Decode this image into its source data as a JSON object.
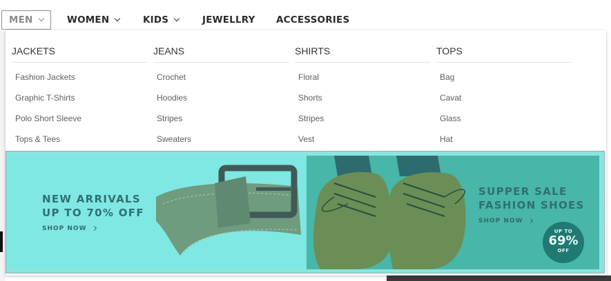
{
  "nav": {
    "items": [
      {
        "label": "MEN",
        "active": true
      },
      {
        "label": "WOMEN",
        "dropdown": true
      },
      {
        "label": "KIDS",
        "dropdown": true
      },
      {
        "label": "JEWELLRY",
        "dropdown": false
      },
      {
        "label": "ACCESSORIES",
        "dropdown": false
      }
    ]
  },
  "mega": {
    "columns": [
      {
        "title": "JACKETS",
        "links": [
          "Fashion Jackets",
          "Graphic T-Shirts",
          "Polo Short Sleeve",
          "Tops & Tees"
        ]
      },
      {
        "title": "JEANS",
        "links": [
          "Crochet",
          "Hoodies",
          "Stripes",
          "Sweaters"
        ]
      },
      {
        "title": "SHIRTS",
        "links": [
          "Floral",
          "Shorts",
          "Stripes",
          "Vest"
        ]
      },
      {
        "title": "TOPS",
        "links": [
          "Bag",
          "Cavat",
          "Glass",
          "Hat"
        ]
      }
    ]
  },
  "banners": {
    "left": {
      "line1": "NEW ARRIVALS",
      "line2": "UP TO 70% OFF",
      "cta": "SHOP NOW",
      "image": "leather-belt"
    },
    "right": {
      "line1": "SUPPER SALE",
      "line2": "FASHION SHOES",
      "cta": "SHOP NOW",
      "image": "leather-shoes",
      "badge": {
        "top": "UP TO",
        "value": "69%",
        "bottom": "OFF"
      }
    }
  },
  "colors": {
    "banner_tint": "#8be4df",
    "banner_text": "#2f7070",
    "badge_bg": "#1f7a73"
  }
}
